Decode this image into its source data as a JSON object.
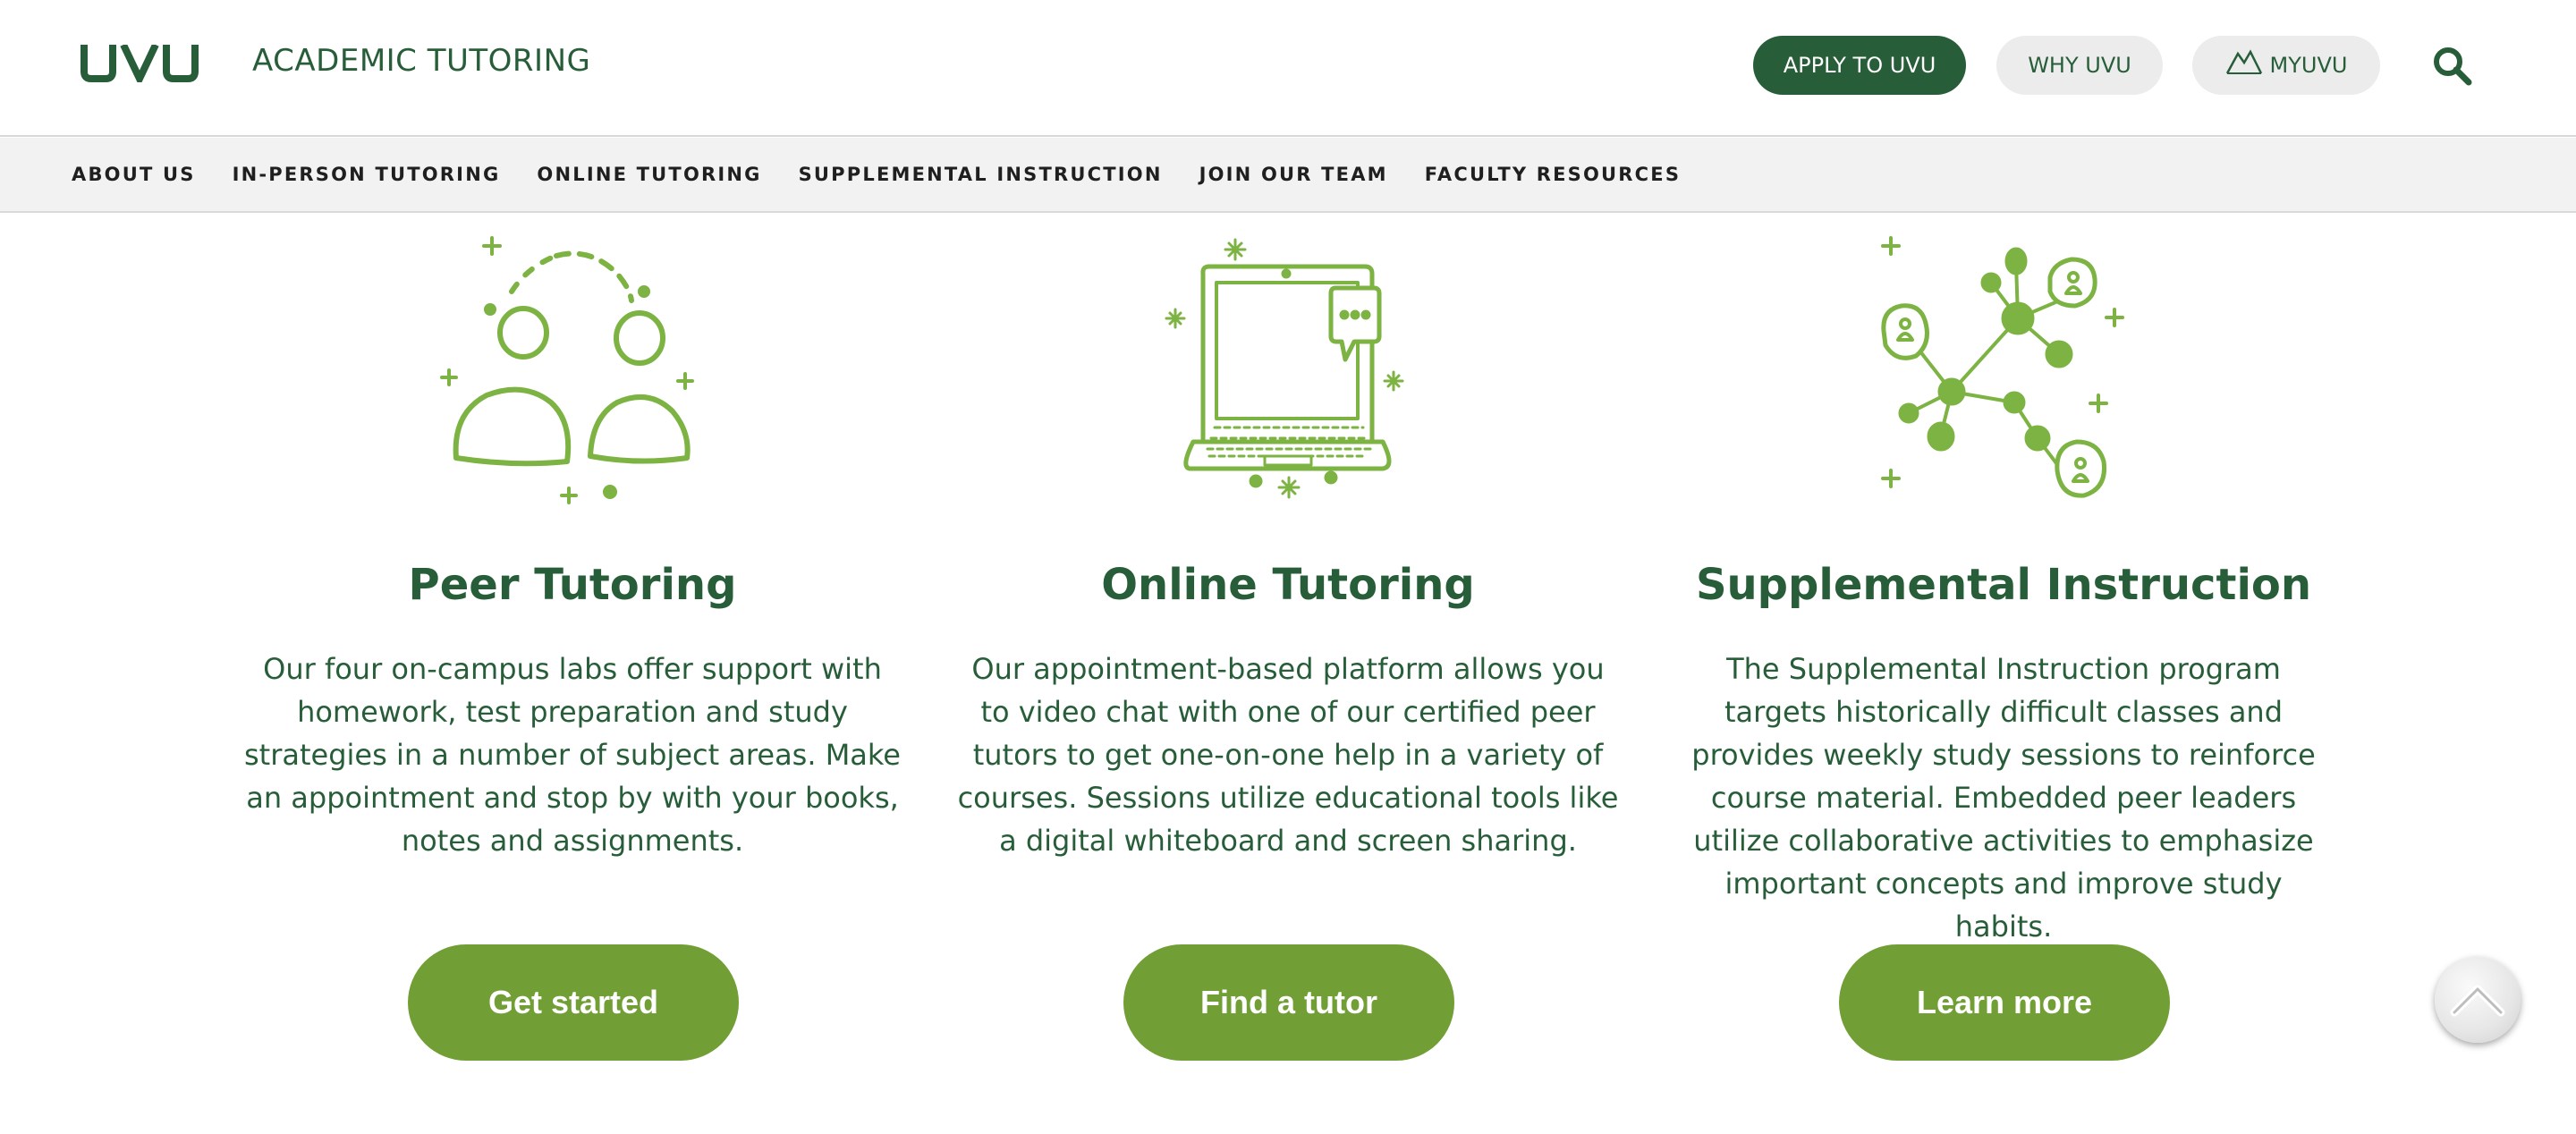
{
  "header": {
    "logo_text": "UVU",
    "site_title": "ACADEMIC TUTORING",
    "apply_label": "APPLY TO UVU",
    "why_label": "WHY UVU",
    "myuvu_label": "MYUVU",
    "search_icon": "search-icon"
  },
  "nav": {
    "items": [
      {
        "label": "ABOUT US"
      },
      {
        "label": "IN-PERSON TUTORING"
      },
      {
        "label": "ONLINE TUTORING"
      },
      {
        "label": "SUPPLEMENTAL INSTRUCTION"
      },
      {
        "label": "JOIN OUR TEAM"
      },
      {
        "label": "FACULTY RESOURCES"
      }
    ]
  },
  "columns": [
    {
      "icon": "peer-tutoring-illustration-icon",
      "title": "Peer Tutoring",
      "text": "Our four on-campus labs offer support with homework, test preparation and study strategies in a number of subject areas. Make an appointment and stop by with your books, notes and assignments.",
      "button": "Get started"
    },
    {
      "icon": "laptop-chat-illustration-icon",
      "title": "Online Tutoring",
      "text": "Our appointment-based platform allows you to video chat with one of our certified peer tutors to get one-on-one help in a variety of courses. Sessions utilize educational tools like a digital whiteboard and screen sharing.",
      "button": "Find a tutor"
    },
    {
      "icon": "network-illustration-icon",
      "title": "Supplemental Instruction",
      "text": "The Supplemental Instruction program targets historically difficult classes and provides weekly study sessions to reinforce course material. Embedded peer leaders utilize collaborative activities to emphasize important concepts and improve study habits.",
      "button": "Learn more"
    }
  ],
  "back_to_top_icon": "chevron-up-icon",
  "colors": {
    "uvu_green": "#275d38",
    "accent_green": "#719f36",
    "illustration_green": "#7cb342",
    "nav_bg": "#f2f2f2",
    "pill_gray": "#ececec"
  }
}
